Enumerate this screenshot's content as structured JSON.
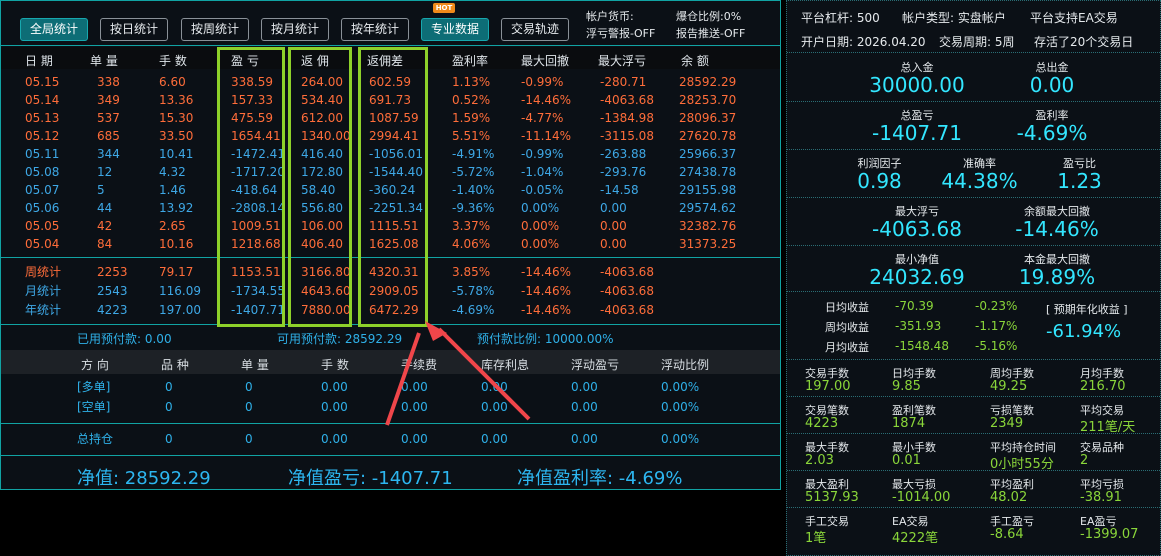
{
  "toolbar": {
    "buttons": [
      "全局统计",
      "按日统计",
      "按周统计",
      "按月统计",
      "按年统计",
      "专业数据",
      "交易轨迹"
    ],
    "hot_badge": "HOT",
    "info1": "帐户货币:",
    "info2": "浮亏警报-OFF",
    "info3": "爆仓比例:0%",
    "info4": "报告推送-OFF"
  },
  "table": {
    "headers": [
      "日 期",
      "单 量",
      "手 数",
      "盈 亏",
      "返 佣",
      "返佣差",
      "盈利率",
      "最大回撤",
      "最大浮亏",
      "余 额"
    ],
    "rows": [
      {
        "date": "05.15",
        "count": "338",
        "lots": "6.60",
        "pnl": "338.59",
        "rebate": "264.00",
        "diff": "602.59",
        "rate": "1.13%",
        "dd": "-0.99%",
        "float": "-280.71",
        "balance": "28592.29",
        "color": "red"
      },
      {
        "date": "05.14",
        "count": "349",
        "lots": "13.36",
        "pnl": "157.33",
        "rebate": "534.40",
        "diff": "691.73",
        "rate": "0.52%",
        "dd": "-14.46%",
        "float": "-4063.68",
        "balance": "28253.70",
        "color": "red"
      },
      {
        "date": "05.13",
        "count": "537",
        "lots": "15.30",
        "pnl": "475.59",
        "rebate": "612.00",
        "diff": "1087.59",
        "rate": "1.59%",
        "dd": "-4.77%",
        "float": "-1384.98",
        "balance": "28096.37",
        "color": "red"
      },
      {
        "date": "05.12",
        "count": "685",
        "lots": "33.50",
        "pnl": "1654.41",
        "rebate": "1340.00",
        "diff": "2994.41",
        "rate": "5.51%",
        "dd": "-11.14%",
        "float": "-3115.08",
        "balance": "27620.78",
        "color": "red"
      },
      {
        "date": "05.11",
        "count": "344",
        "lots": "10.41",
        "pnl": "-1472.41",
        "rebate": "416.40",
        "diff": "-1056.01",
        "rate": "-4.91%",
        "dd": "-0.99%",
        "float": "-263.88",
        "balance": "25966.37",
        "color": "blue"
      },
      {
        "date": "05.08",
        "count": "12",
        "lots": "4.32",
        "pnl": "-1717.20",
        "rebate": "172.80",
        "diff": "-1544.40",
        "rate": "-5.72%",
        "dd": "-1.04%",
        "float": "-293.76",
        "balance": "27438.78",
        "color": "blue"
      },
      {
        "date": "05.07",
        "count": "5",
        "lots": "1.46",
        "pnl": "-418.64",
        "rebate": "58.40",
        "diff": "-360.24",
        "rate": "-1.40%",
        "dd": "-0.05%",
        "float": "-14.58",
        "balance": "29155.98",
        "color": "blue"
      },
      {
        "date": "05.06",
        "count": "44",
        "lots": "13.92",
        "pnl": "-2808.14",
        "rebate": "556.80",
        "diff": "-2251.34",
        "rate": "-9.36%",
        "dd": "0.00%",
        "float": "0.00",
        "balance": "29574.62",
        "color": "blue"
      },
      {
        "date": "05.05",
        "count": "42",
        "lots": "2.65",
        "pnl": "1009.51",
        "rebate": "106.00",
        "diff": "1115.51",
        "rate": "3.37%",
        "dd": "0.00%",
        "float": "0.00",
        "balance": "32382.76",
        "color": "red"
      },
      {
        "date": "05.04",
        "count": "84",
        "lots": "10.16",
        "pnl": "1218.68",
        "rebate": "406.40",
        "diff": "1625.08",
        "rate": "4.06%",
        "dd": "0.00%",
        "float": "0.00",
        "balance": "31373.25",
        "color": "red"
      }
    ],
    "summary": [
      {
        "label": "周统计",
        "count": "2253",
        "lots": "79.17",
        "pnl": "1153.51",
        "rebate": "3166.80",
        "diff": "4320.31",
        "rate": "3.85%",
        "dd": "-14.46%",
        "float": "-4063.68",
        "color": "red"
      },
      {
        "label": "月统计",
        "count": "2543",
        "lots": "116.09",
        "pnl": "-1734.55",
        "rebate": "4643.60",
        "diff": "2909.05",
        "rate": "-5.78%",
        "dd": "-14.46%",
        "float": "-4063.68",
        "color": "blue"
      },
      {
        "label": "年统计",
        "count": "4223",
        "lots": "197.00",
        "pnl": "-1407.71",
        "rebate": "7880.00",
        "diff": "6472.29",
        "rate": "-4.69%",
        "dd": "-14.46%",
        "float": "-4063.68",
        "color": "blue"
      }
    ]
  },
  "prepay": {
    "used": "已用预付款: 0.00",
    "available": "可用预付款: 28592.29",
    "ratio": "预付款比例: 10000.00%"
  },
  "positions": {
    "headers": [
      "方 向",
      "品 种",
      "单 量",
      "手 数",
      "手续费",
      "库存利息",
      "浮动盈亏",
      "浮动比例"
    ],
    "rows": [
      {
        "dir": "[多单]",
        "v": [
          "0",
          "0",
          "0.00",
          "0.00",
          "0.00",
          "0.00",
          "0.00%"
        ]
      },
      {
        "dir": "[空单]",
        "v": [
          "0",
          "0",
          "0.00",
          "0.00",
          "0.00",
          "0.00",
          "0.00%"
        ]
      }
    ],
    "total": {
      "dir": "总持仓",
      "v": [
        "0",
        "0",
        "0.00",
        "0.00",
        "0.00",
        "0.00",
        "0.00%"
      ]
    }
  },
  "bottom": {
    "equity": "净值: 28592.29",
    "equity_pnl": "净值盈亏: -1407.71",
    "equity_rate": "净值盈利率: -4.69%"
  },
  "right": {
    "leverage": "平台杠杆: 500",
    "account_type": "帐户类型: 实盘帐户",
    "ea_support": "平台支持EA交易",
    "open_date": "开户日期: 2026.04.20",
    "period": "交易周期: 5周",
    "saved": "存活了20个交易日",
    "kpi": [
      {
        "label": "总入金",
        "value": "30000.00"
      },
      {
        "label": "总出金",
        "value": "0.00"
      },
      {
        "label": "总盈亏",
        "value": "-1407.71"
      },
      {
        "label": "盈利率",
        "value": "-4.69%"
      },
      {
        "label": "利润因子",
        "value": "0.98"
      },
      {
        "label": "准确率",
        "value": "44.38%"
      },
      {
        "label": "盈亏比",
        "value": "1.23"
      },
      {
        "label": "最大浮亏",
        "value": "-4063.68"
      },
      {
        "label": "余额最大回撤",
        "value": "-14.46%"
      },
      {
        "label": "最小净值",
        "value": "24032.69"
      },
      {
        "label": "本金最大回撤",
        "value": "19.89%"
      }
    ],
    "daily": [
      {
        "label": "日均收益",
        "v1": "-70.39",
        "v2": "-0.23%"
      },
      {
        "label": "周均收益",
        "v1": "-351.93",
        "v2": "-1.17%"
      },
      {
        "label": "月均收益",
        "v1": "-1548.48",
        "v2": "-5.16%"
      }
    ],
    "forecast_label": "[ 预期年化收益 ]",
    "forecast_value": "-61.94%",
    "grid": [
      [
        {
          "l": "交易手数",
          "v": "197.00"
        },
        {
          "l": "日均手数",
          "v": "9.85"
        },
        {
          "l": "周均手数",
          "v": "49.25"
        },
        {
          "l": "月均手数",
          "v": "216.70"
        }
      ],
      [
        {
          "l": "交易笔数",
          "v": "4223"
        },
        {
          "l": "盈利笔数",
          "v": "1874"
        },
        {
          "l": "亏损笔数",
          "v": "2349"
        },
        {
          "l": "平均交易",
          "v": "211笔/天"
        }
      ],
      [
        {
          "l": "最大手数",
          "v": "2.03"
        },
        {
          "l": "最小手数",
          "v": "0.01"
        },
        {
          "l": "平均持仓时间",
          "v": "0小时55分"
        },
        {
          "l": "交易品种",
          "v": "2"
        }
      ],
      [
        {
          "l": "最大盈利",
          "v": "5137.93"
        },
        {
          "l": "最大亏损",
          "v": "-1014.00"
        },
        {
          "l": "平均盈利",
          "v": "48.02"
        },
        {
          "l": "平均亏损",
          "v": "-38.91"
        }
      ],
      [
        {
          "l": "手工交易",
          "v": "1笔"
        },
        {
          "l": "EA交易",
          "v": "4222笔"
        },
        {
          "l": "手工盈亏",
          "v": "-8.64"
        },
        {
          "l": "EA盈亏",
          "v": "-1399.07"
        }
      ]
    ]
  }
}
